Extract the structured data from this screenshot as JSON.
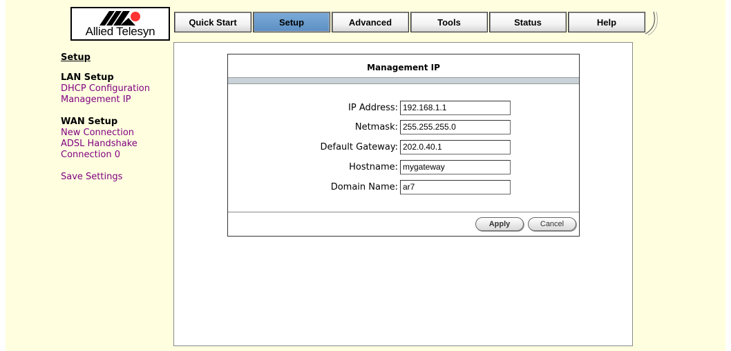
{
  "brand": {
    "name": "Allied Telesyn",
    "logo_color": "#ff3333"
  },
  "tabs": [
    {
      "label": "Quick Start",
      "active": false
    },
    {
      "label": "Setup",
      "active": true
    },
    {
      "label": "Advanced",
      "active": false
    },
    {
      "label": "Tools",
      "active": false
    },
    {
      "label": "Status",
      "active": false
    },
    {
      "label": "Help",
      "active": false
    }
  ],
  "sidebar": {
    "title": "Setup",
    "lan_heading": "LAN Setup",
    "lan_links": [
      "DHCP Configuration",
      "Management IP"
    ],
    "wan_heading": "WAN Setup",
    "wan_links": [
      "New Connection",
      "ADSL Handshake",
      "Connection 0"
    ],
    "save_label": "Save Settings"
  },
  "form": {
    "title": "Management IP",
    "fields": [
      {
        "label": "IP Address:",
        "value": "192.168.1.1"
      },
      {
        "label": "Netmask:",
        "value": "255.255.255.0"
      },
      {
        "label": "Default Gateway:",
        "value": "202.0.40.1"
      },
      {
        "label": "Hostname:",
        "value": "mygateway"
      },
      {
        "label": "Domain Name:",
        "value": "ar7"
      }
    ],
    "apply_label": "Apply",
    "cancel_label": "Cancel"
  },
  "colors": {
    "background": "#ffffe0",
    "active_tab": "#6b9bd0",
    "link": "#800080"
  }
}
